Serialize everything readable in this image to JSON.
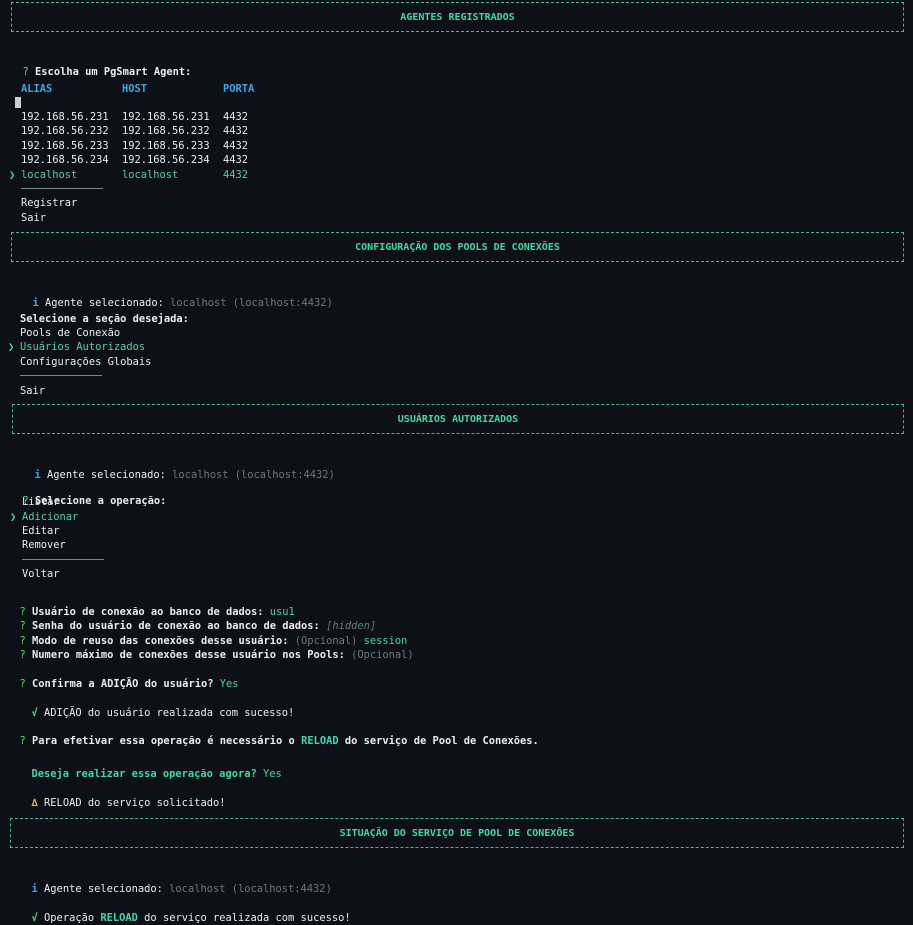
{
  "section1": {
    "title": "AGENTES REGISTRADOS",
    "prompt_mark": "?",
    "prompt": "Escolha um PgSmart Agent:",
    "headers": [
      "ALIAS",
      "HOST",
      "PORTA"
    ],
    "rows": [
      [
        "192.168.56.231",
        "192.168.56.231",
        "4432"
      ],
      [
        "192.168.56.232",
        "192.168.56.232",
        "4432"
      ],
      [
        "192.168.56.233",
        "192.168.56.233",
        "4432"
      ],
      [
        "192.168.56.234",
        "192.168.56.234",
        "4432"
      ]
    ],
    "selected_marker": "❯",
    "selected_row": [
      "localhost",
      "localhost",
      "4432"
    ],
    "actions": [
      "Registrar",
      "Sair"
    ]
  },
  "section2": {
    "title": "CONFIGURAÇÃO DOS POOLS DE CONEXÕES",
    "info_icon": "i",
    "agent_label": "Agente selecionado:",
    "agent_value": "localhost (localhost:4432)",
    "prompt": "Selecione a seção desejada:",
    "options": [
      "Pools de Conexão",
      "Usuários Autorizados",
      "Configurações Globais"
    ],
    "selected_marker": "❯",
    "exit": "Sair"
  },
  "section3": {
    "title": "USUÁRIOS AUTORIZADOS",
    "info_icon": "i",
    "agent_label": "Agente selecionado:",
    "agent_value": "localhost (localhost:4432)",
    "prompt_mark": "?",
    "prompt": "Selecione a operação:",
    "options": [
      "Listar",
      "Adicionar",
      "Editar",
      "Remover"
    ],
    "selected_marker": "❯",
    "back": "Voltar"
  },
  "form": {
    "mark": "?",
    "q1_label": "Usuário de conexão ao banco de dados:",
    "q1_value": "usu1",
    "q2_label": "Senha do usuário de conexão ao banco de dados:",
    "q2_value": "[hidden]",
    "q3_label": "Modo de reuso das conexões desse usuário:",
    "q3_optional": "(Opcional)",
    "q3_value": "session",
    "q4_label": "Numero máximo de conexões desse usuário nos Pools:",
    "q4_optional": "(Opcional)",
    "confirm_label": "Confirma a ADIÇÃO do usuário?",
    "confirm_value": "Yes",
    "success_icon": "√",
    "success_text": "ADIÇÃO do usuário realizada com sucesso!",
    "reload_pre": "Para efetivar essa operação é necessário o",
    "reload_word": "RELOAD",
    "reload_post": "do serviço de Pool de Conexões.",
    "now_label": "Deseja realizar essa operação agora?",
    "now_value": "Yes",
    "warn_icon": "∆",
    "warn_text": "RELOAD do serviço solicitado!"
  },
  "section4": {
    "title": "SITUAÇÃO DO SERVIÇO DE POOL DE CONEXÕES",
    "info_icon": "i",
    "agent_label": "Agente selecionado:",
    "agent_value": "localhost (localhost:4432)",
    "success_icon": "√",
    "op_pre": "Operação",
    "op_word": "RELOAD",
    "op_post": "do serviço realizada com sucesso!"
  },
  "colors": {
    "background": "#0d1117",
    "accent": "#3fd6b4",
    "header_blue": "#3ba7e6",
    "muted": "#6e7681",
    "warning": "#e3b341"
  }
}
